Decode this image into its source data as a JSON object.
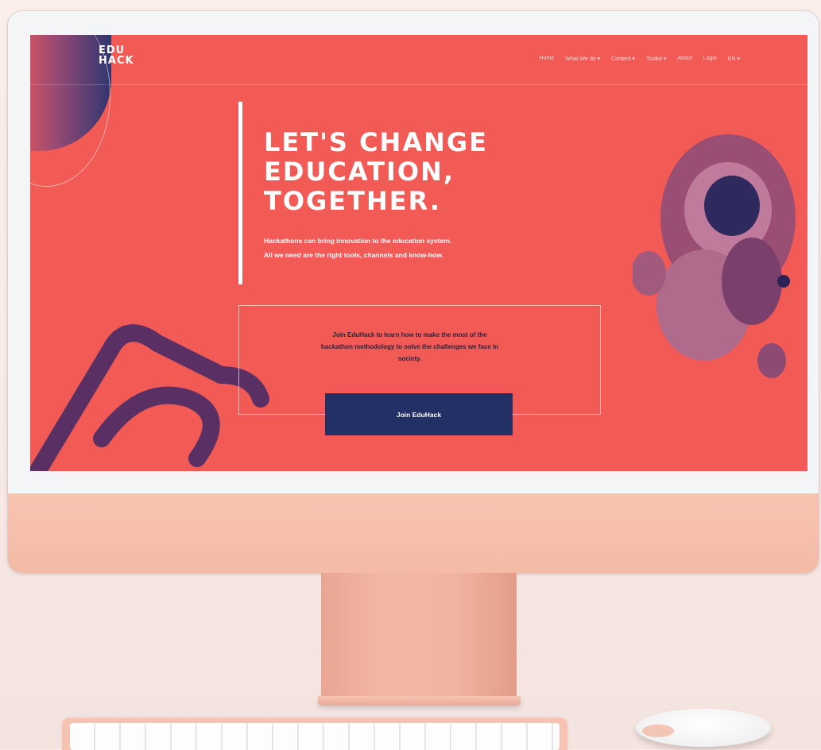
{
  "site": {
    "logo_line1": "EDU",
    "logo_line2": "HACK",
    "nav": [
      "Home",
      "What We do ▾",
      "Content ▾",
      "Toolkit ▾",
      "About",
      "Login",
      "EN ▾"
    ]
  },
  "hero": {
    "title_line1": "LET'S CHANGE",
    "title_line2": "EDUCATION,",
    "title_line3": "TOGETHER.",
    "subtitle_line1": "Hackathons can bring innovation to the education system.",
    "subtitle_line2": "All we need are the right tools, channels and know-how."
  },
  "join": {
    "text": "Join EduHack to learn how to make the most of the hackathon methodology to solve the challenges we face in society.",
    "button_label": "Join EduHack"
  },
  "colors": {
    "primary": "#f25a55",
    "navy": "#223066",
    "device": "#f4bba6"
  },
  "icons": [
    "glasses-image",
    "astronaut-image",
    "camera-icon"
  ]
}
